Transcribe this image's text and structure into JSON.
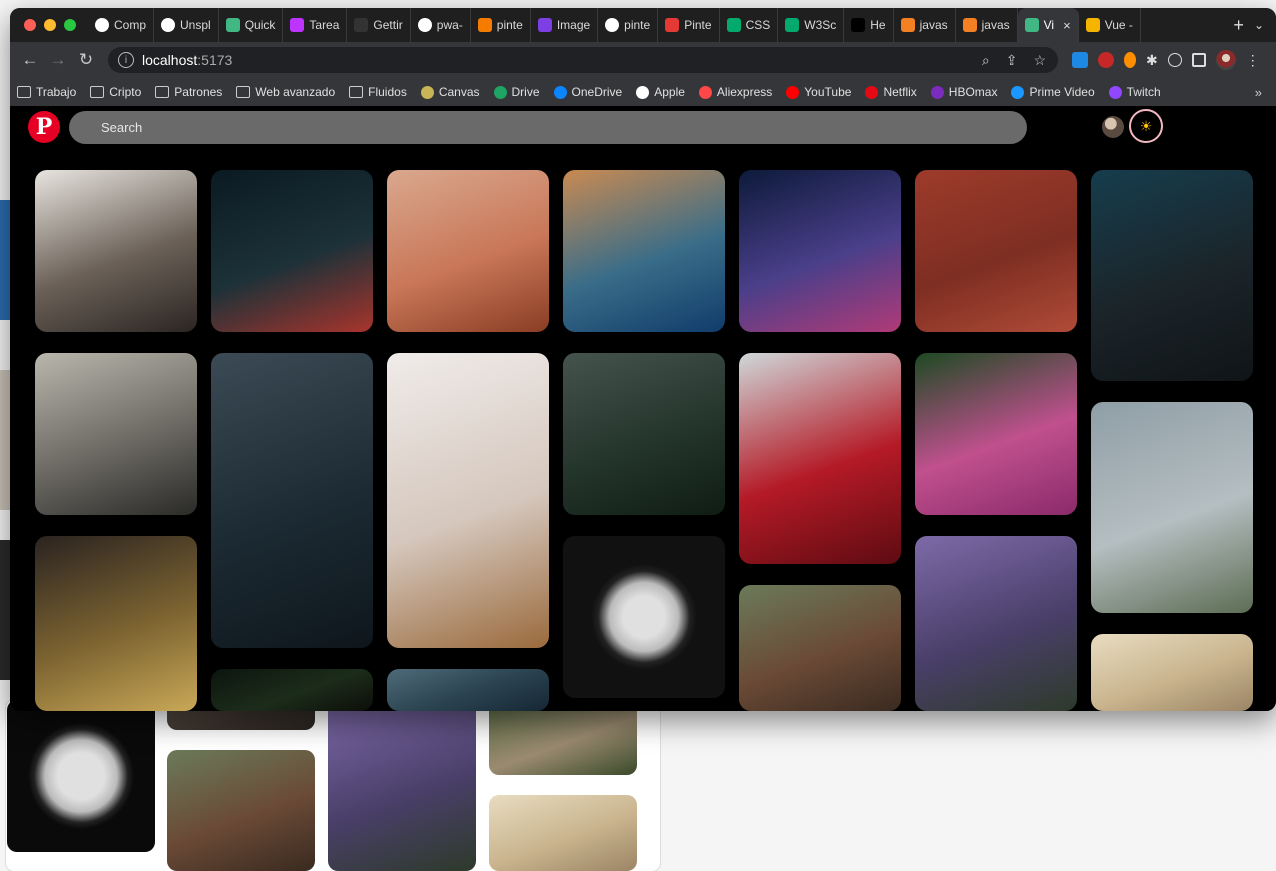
{
  "window": {
    "traffic_colors": [
      "#ff5f57",
      "#febc2e",
      "#28c840"
    ]
  },
  "tabs": [
    {
      "label": "Comp",
      "icon": "github-icon",
      "color": "#ffffff"
    },
    {
      "label": "Unspl",
      "icon": "unsplash-icon",
      "color": "#ffffff"
    },
    {
      "label": "Quick",
      "icon": "vue-icon",
      "color": "#41b883"
    },
    {
      "label": "Tarea",
      "icon": "vite-icon",
      "color": "#bd34fe"
    },
    {
      "label": "Gettir",
      "icon": "medium-icon",
      "color": "#333333"
    },
    {
      "label": "pwa-",
      "icon": "github-icon",
      "color": "#ffffff"
    },
    {
      "label": "pinte",
      "icon": "orange-icon",
      "color": "#f57c00"
    },
    {
      "label": "Image",
      "icon": "jpg-icon",
      "color": "#7b3fe4"
    },
    {
      "label": "pinte",
      "icon": "google-icon",
      "color": "#ffffff"
    },
    {
      "label": "Pinte",
      "icon": "stripe-icon",
      "color": "#e53935"
    },
    {
      "label": "CSS",
      "icon": "w3-icon",
      "color": "#04aa6d"
    },
    {
      "label": "W3Sc",
      "icon": "w3-icon",
      "color": "#04aa6d"
    },
    {
      "label": "He",
      "icon": "dev-icon",
      "color": "#000000"
    },
    {
      "label": "javas",
      "icon": "stack-icon",
      "color": "#f48024"
    },
    {
      "label": "javas",
      "icon": "stack-icon",
      "color": "#f48024"
    },
    {
      "label": "Vi",
      "icon": "vue-icon",
      "color": "#41b883",
      "active": true
    },
    {
      "label": "Vue -",
      "icon": "slides-icon",
      "color": "#f4b400"
    }
  ],
  "toolbar": {
    "host": "localhost",
    "port": ":5173"
  },
  "bookmarks": [
    {
      "label": "Trabajo",
      "icon": "folder-icon",
      "color": ""
    },
    {
      "label": "Cripto",
      "icon": "folder-icon",
      "color": ""
    },
    {
      "label": "Patrones",
      "icon": "folder-icon",
      "color": ""
    },
    {
      "label": "Web avanzado",
      "icon": "folder-icon",
      "color": ""
    },
    {
      "label": "Fluidos",
      "icon": "folder-icon",
      "color": ""
    },
    {
      "label": "Canvas",
      "icon": "canvas-icon",
      "color": "#c9b458"
    },
    {
      "label": "Drive",
      "icon": "drive-icon",
      "color": "#1fa463"
    },
    {
      "label": "OneDrive",
      "icon": "onedrive-icon",
      "color": "#0a84ff"
    },
    {
      "label": "Apple",
      "icon": "apple-icon",
      "color": "#ffffff"
    },
    {
      "label": "Aliexpress",
      "icon": "aliexpress-icon",
      "color": "#ff4747"
    },
    {
      "label": "YouTube",
      "icon": "youtube-icon",
      "color": "#ff0000"
    },
    {
      "label": "Netflix",
      "icon": "netflix-icon",
      "color": "#e50914"
    },
    {
      "label": "HBOmax",
      "icon": "hbomax-icon",
      "color": "#7b2cbf"
    },
    {
      "label": "Prime Video",
      "icon": "primevideo-icon",
      "color": "#1a98ff"
    },
    {
      "label": "Twitch",
      "icon": "twitch-icon",
      "color": "#9146ff"
    }
  ],
  "bookmarks_more": "»",
  "app": {
    "logo": "P",
    "search_placeholder": "Search",
    "theme_icon": "☀"
  },
  "pins": [
    {
      "name": "woman-window",
      "colors": [
        "#e8e4df",
        "#6b6158",
        "#2b2522"
      ]
    },
    {
      "name": "underwater-diver",
      "colors": [
        "#0b1a22",
        "#1c3138",
        "#a8342c"
      ]
    },
    {
      "name": "desert-rock",
      "colors": [
        "#d9a88e",
        "#c97758",
        "#8a3d24"
      ]
    },
    {
      "name": "split-sea-rock",
      "colors": [
        "#c98a52",
        "#3a6d88",
        "#103c6b"
      ]
    },
    {
      "name": "city-night",
      "colors": [
        "#0d1a3a",
        "#4a3f8a",
        "#b03a77"
      ]
    },
    {
      "name": "red-sand-dunes",
      "colors": [
        "#9d3b2b",
        "#7e2e22",
        "#b04b38"
      ]
    },
    {
      "name": "dark-tower",
      "colors": [
        "#163d4d",
        "#1b2429",
        "#0f1417"
      ]
    },
    {
      "name": "woman-stairs",
      "colors": [
        "#b9b6ad",
        "#6d6a64",
        "#2a2a28"
      ]
    },
    {
      "name": "tokyo-street",
      "colors": [
        "#3c4a55",
        "#1c2a33",
        "#0e161c"
      ]
    },
    {
      "name": "white-interior",
      "colors": [
        "#f0ecea",
        "#d5c7bd",
        "#9a6a3c"
      ]
    },
    {
      "name": "misty-forest",
      "colors": [
        "#45534d",
        "#24352c",
        "#0f1c14"
      ]
    },
    {
      "name": "red-lounge",
      "colors": [
        "#cfd8da",
        "#b41a26",
        "#5e0b12"
      ]
    },
    {
      "name": "pink-tulips",
      "colors": [
        "#1d4a22",
        "#c0508e",
        "#8b2a6a"
      ]
    },
    {
      "name": "foggy-valley",
      "colors": [
        "#8f9ea6",
        "#b5bec1",
        "#5d6d54"
      ]
    },
    {
      "name": "golden-flowers",
      "colors": [
        "#2a2320",
        "#7d6431",
        "#c9a857"
      ]
    },
    {
      "name": "dark-leaves",
      "colors": [
        "#0c150e",
        "#1c2c1a",
        "#0c0e0a"
      ]
    },
    {
      "name": "ocean-waves",
      "colors": [
        "#4e6a78",
        "#2a4250",
        "#152633"
      ]
    },
    {
      "name": "white-sphere",
      "colors": [
        "#111111",
        "#e0e0e0",
        "#bbbbbb"
      ]
    },
    {
      "name": "woman-hair",
      "colors": [
        "#6b7a5a",
        "#6a4a36",
        "#3a2a20"
      ]
    },
    {
      "name": "lilac-woman",
      "colors": [
        "#7d6aa8",
        "#4a3f6a",
        "#2d3a2a"
      ]
    },
    {
      "name": "wooden-wall",
      "colors": [
        "#e8dcc0",
        "#c9b48e",
        "#9b8565"
      ]
    }
  ],
  "bg_tiles": [
    {
      "name": "bg-white-sphere",
      "colors": [
        "#0a0a0a",
        "#e0e0e0",
        "#bbbbbb"
      ]
    },
    {
      "name": "bg-dark-strip",
      "colors": [
        "#5a4d44",
        "#3a322c",
        "#2a2420"
      ]
    },
    {
      "name": "bg-woman-hair",
      "colors": [
        "#6b7a5a",
        "#6a4a36",
        "#3a2a20"
      ]
    },
    {
      "name": "bg-lilac-woman",
      "colors": [
        "#7d6aa8",
        "#4a3f6a",
        "#2d3a2a"
      ]
    },
    {
      "name": "bg-road",
      "colors": [
        "#596b44",
        "#9a8a70",
        "#3a4a2a"
      ]
    },
    {
      "name": "bg-wooden-wall",
      "colors": [
        "#e8dcc0",
        "#c9b48e",
        "#9b8565"
      ]
    }
  ]
}
